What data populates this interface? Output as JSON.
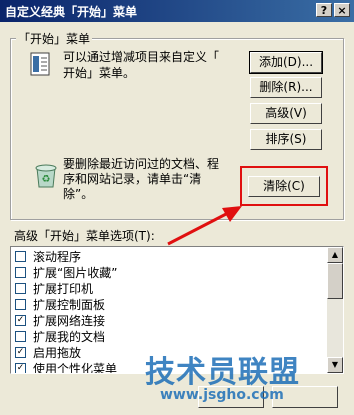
{
  "window": {
    "title": "自定义经典「开始」菜单",
    "help_btn": "?",
    "close_btn": "×"
  },
  "start_group": {
    "legend": "「开始」菜单",
    "description_line1": "可以通过增减项目来自定义「",
    "description_line2": "开始」菜单。",
    "buttons": {
      "add": "添加(D)...",
      "remove": "删除(R)...",
      "advanced": "高级(V)",
      "sort": "排序(S)"
    },
    "clear_desc_line1": "要删除最近访问过的文档、程",
    "clear_desc_line2": "序和网站记录，请单击“清",
    "clear_desc_line3": "除”。",
    "clear_button": "清除(C)"
  },
  "advanced": {
    "label": "高级「开始」菜单选项(T):",
    "items": [
      {
        "label": "滚动程序",
        "checked": false
      },
      {
        "label": "扩展“图片收藏”",
        "checked": false
      },
      {
        "label": "扩展打印机",
        "checked": false
      },
      {
        "label": "扩展控制面板",
        "checked": false
      },
      {
        "label": "扩展网络连接",
        "checked": true
      },
      {
        "label": "扩展我的文档",
        "checked": false
      },
      {
        "label": "启用拖放",
        "checked": true
      },
      {
        "label": "使用个性化菜单",
        "checked": true
      }
    ]
  },
  "watermark": {
    "main": "技术员联盟",
    "url": "www.jsgho.com"
  },
  "colors": {
    "highlight": "#e01010",
    "titlebar": "#0a246a"
  }
}
